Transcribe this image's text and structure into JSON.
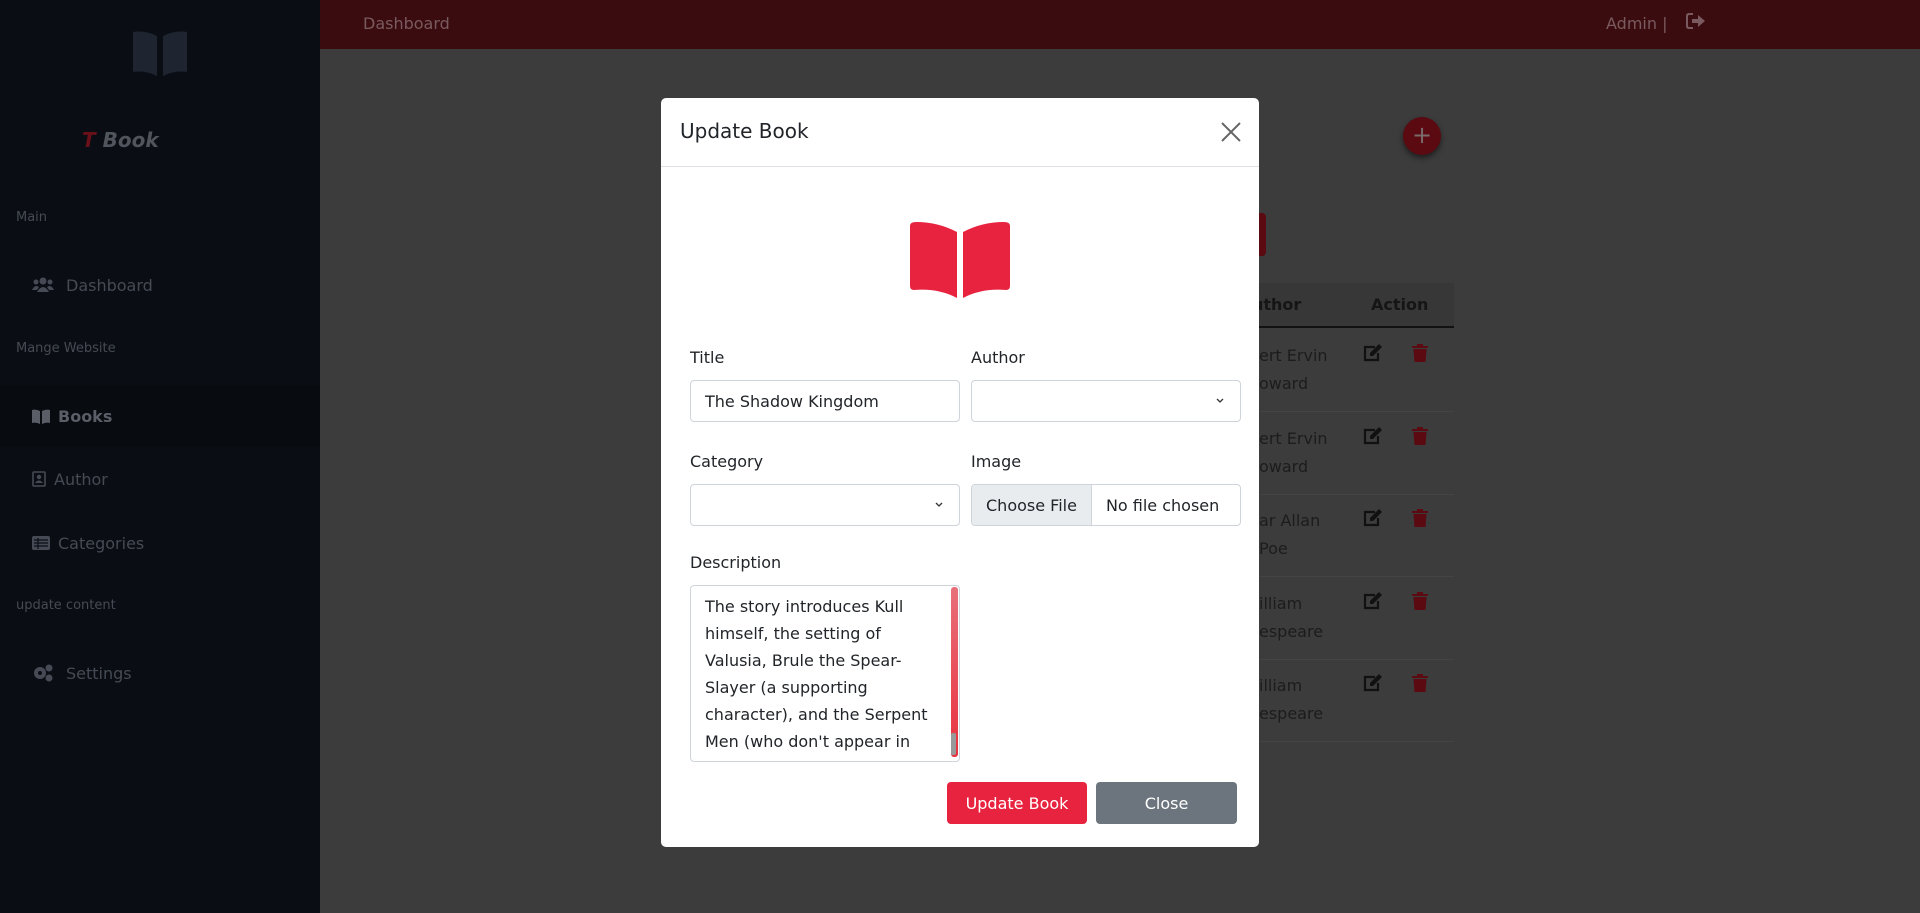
{
  "sidebar": {
    "brand_t": "T",
    "brand_name": "Book",
    "sections": [
      "Main",
      "Mange Website",
      "update content"
    ],
    "items": [
      {
        "label": "Dashboard",
        "icon": "users-icon"
      },
      {
        "label": "Books",
        "icon": "book-open-icon",
        "active": true
      },
      {
        "label": "Author",
        "icon": "address-card-icon"
      },
      {
        "label": "Categories",
        "icon": "list-icon"
      },
      {
        "label": "Settings",
        "icon": "cogs-icon"
      }
    ]
  },
  "header": {
    "breadcrumb": "Dashboard",
    "user": "Admin |"
  },
  "table": {
    "headers": {
      "author": "uthor",
      "action": "Action"
    },
    "rows": [
      [
        "ert Ervin",
        "oward"
      ],
      [
        "ert Ervin",
        "oward"
      ],
      [
        "ar Allan",
        "Poe"
      ],
      [
        "illiam",
        "espeare"
      ],
      [
        "illiam",
        "espeare"
      ]
    ]
  },
  "modal": {
    "title": "Update Book",
    "title_label": "Title",
    "title_value": "The Shadow Kingdom",
    "author_label": "Author",
    "author_value": "",
    "category_label": "Category",
    "category_value": "",
    "image_label": "Image",
    "choose_file": "Choose File",
    "no_file": "No file chosen",
    "description_label": "Description",
    "description_value": "The story introduces Kull himself, the setting of Valusia, Brule the Spear-Slayer (a supporting character), and the Serpent Men (who don't appear in any other work by",
    "update_button": "Update Book",
    "close_button": "Close"
  },
  "colors": {
    "accent": "#e8313f",
    "secondary": "#6c757d"
  }
}
